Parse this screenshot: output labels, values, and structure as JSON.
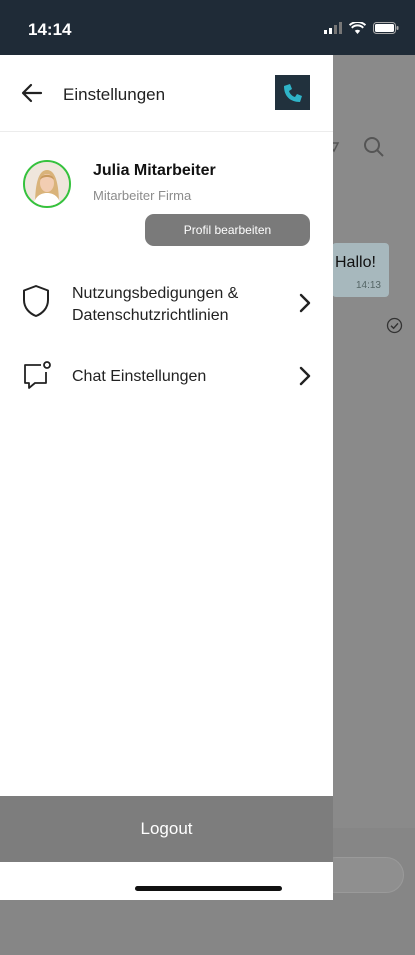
{
  "status_bar": {
    "time": "14:14"
  },
  "background_chat": {
    "message": "Hallo!",
    "message_time": "14:13"
  },
  "drawer": {
    "title": "Einstellungen",
    "profile": {
      "name": "Julia Mitarbeiter",
      "company": "Mitarbeiter Firma",
      "edit_label": "Profil bearbeiten"
    },
    "menu": [
      {
        "label_line1": "Nutzungsbedigungen &",
        "label_line2": "Datenschutzrichtlinien",
        "icon": "shield-icon"
      },
      {
        "label_line1": "Chat Einstellungen",
        "label_line2": "",
        "icon": "chat-settings-icon"
      }
    ],
    "logout_label": "Logout"
  },
  "colors": {
    "status_bar_bg": "#1f2b37",
    "logo_bg": "#21313d",
    "logo_accent": "#2fb4c8",
    "avatar_ring": "#35c23e",
    "button_gray": "#7a7a7a"
  }
}
